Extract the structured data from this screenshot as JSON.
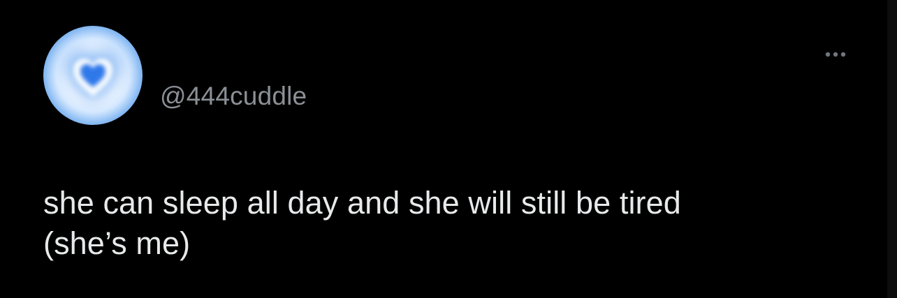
{
  "post": {
    "handle": "@444cuddle",
    "text_lines": [
      "she can sleep all day and she will still be tired",
      "(she’s me)"
    ]
  },
  "avatar": {
    "icon": "heart-icon",
    "colors": {
      "background": "#f7fbff",
      "outer_glow": "#78aef0",
      "heart": "#2e78ea"
    }
  },
  "menu": {
    "icon": "more-icon"
  },
  "theme": {
    "background": "#000000",
    "text": "#e7e9ea",
    "secondary_text": "#8b9096"
  }
}
